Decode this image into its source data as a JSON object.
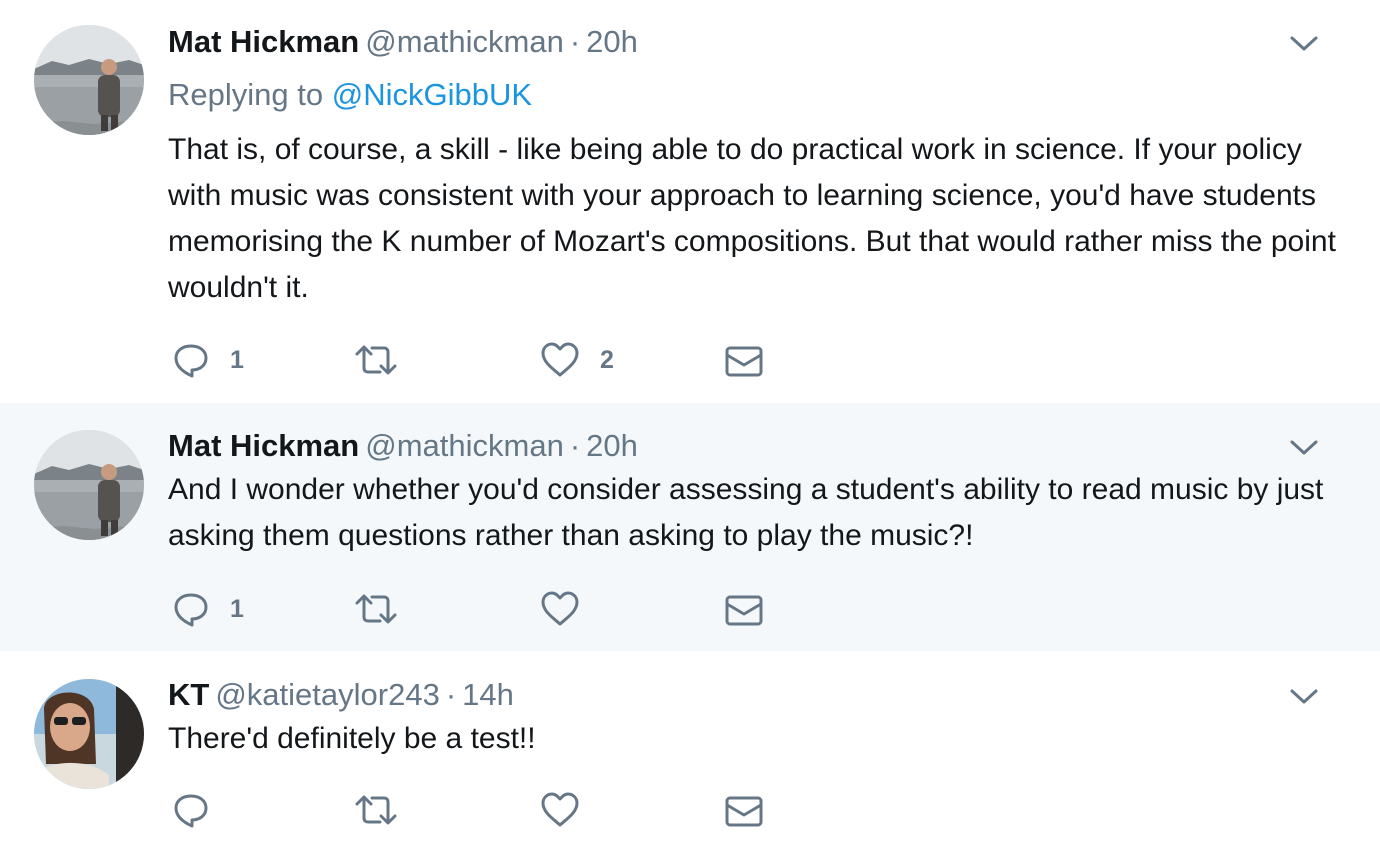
{
  "tweets": [
    {
      "name": "Mat Hickman",
      "handle": "@mathickman",
      "separator": "·",
      "time": "20h",
      "replying_prefix": "Replying to",
      "replying_to": "@NickGibbUK",
      "text": "That is, of course, a skill - like being able to do practical work in science. If your policy with music was consistent with your approach to learning science, you'd have students memorising the K number of Mozart's compositions. But that would rather miss the point wouldn't it.",
      "reply_count": "1",
      "retweet_count": "",
      "like_count": "2",
      "avatar_icon": "user-avatar-man-by-lake"
    },
    {
      "name": "Mat Hickman",
      "handle": "@mathickman",
      "separator": "·",
      "time": "20h",
      "text": "And I wonder whether you'd consider assessing a student's ability to read music by just asking them questions rather than asking to play the music?!",
      "reply_count": "1",
      "retweet_count": "",
      "like_count": "",
      "avatar_icon": "user-avatar-man-by-lake"
    },
    {
      "name": "KT",
      "handle": "@katietaylor243",
      "separator": "·",
      "time": "14h",
      "text": "There'd definitely be a test!!",
      "reply_count": "",
      "retweet_count": "",
      "like_count": "",
      "avatar_icon": "user-avatar-woman-sunglasses"
    }
  ],
  "icons": {
    "reply": "reply-icon",
    "retweet": "retweet-icon",
    "like": "heart-icon",
    "dm": "envelope-icon",
    "menu": "chevron-down-icon"
  },
  "colors": {
    "text": "#14171a",
    "muted": "#657786",
    "link": "#1b95e0",
    "thread_line": "#aad4f5",
    "highlight_bg": "#f5f8fa"
  }
}
